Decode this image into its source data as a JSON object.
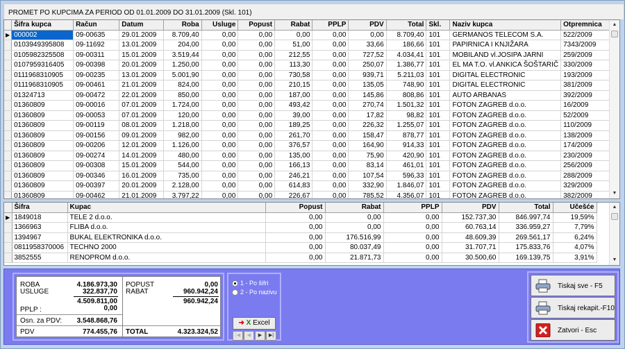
{
  "window": {
    "title": "PROMET PO KUPCIMA ZA PERIOD OD 01.01.2009 DO 31.01.2009 (Skl. 101)"
  },
  "grid1": {
    "columns": [
      "Šifra kupca",
      "Račun",
      "Datum",
      "Roba",
      "Usluge",
      "Popust",
      "Rabat",
      "PPLP",
      "PDV",
      "Total",
      "Skl.",
      "Naziv kupca",
      "Otpremnica"
    ],
    "rows": [
      [
        "000002",
        "09-00635",
        "29.01.2009",
        "8.709,40",
        "0,00",
        "0,00",
        "0,00",
        "0,00",
        "0,00",
        "8.709,40",
        "101",
        "GERMANOS TELECOM S.A.",
        "522/2009"
      ],
      [
        "0103949395808",
        "09-11692",
        "13.01.2009",
        "204,00",
        "0,00",
        "0,00",
        "51,00",
        "0,00",
        "33,66",
        "186,66",
        "101",
        " PAPIRNICA I KNJIŽARA",
        "7343/2009"
      ],
      [
        "0105982325508",
        "09-00311",
        "15.01.2009",
        "3.519,44",
        "0,00",
        "0,00",
        "212,55",
        "0,00",
        "727,52",
        "4.034,41",
        "101",
        "MOBILAND vl.JOSIPA JARNI",
        "259/2009"
      ],
      [
        "0107959316405",
        "09-00398",
        "20.01.2009",
        "1.250,00",
        "0,00",
        "0,00",
        "113,30",
        "0,00",
        "250,07",
        "1.386,77",
        "101",
        "EL MA T.O. vl.ANKICA ŠOŠTARIČ",
        "330/2009"
      ],
      [
        "0111968310905",
        "09-00235",
        "13.01.2009",
        "5.001,90",
        "0,00",
        "0,00",
        "730,58",
        "0,00",
        "939,71",
        "5.211,03",
        "101",
        "DIGITAL ELECTRONIC",
        "193/2009"
      ],
      [
        "0111968310905",
        "09-00461",
        "21.01.2009",
        "824,00",
        "0,00",
        "0,00",
        "210,15",
        "0,00",
        "135,05",
        "748,90",
        "101",
        "DIGITAL ELECTRONIC",
        "381/2009"
      ],
      [
        "01324713",
        "09-00472",
        "22.01.2009",
        "850,00",
        "0,00",
        "0,00",
        "187,00",
        "0,00",
        "145,86",
        "808,86",
        "101",
        "AUTO ARBANAS",
        "392/2009"
      ],
      [
        "01360809",
        "09-00016",
        "07.01.2009",
        "1.724,00",
        "0,00",
        "0,00",
        "493,42",
        "0,00",
        "270,74",
        "1.501,32",
        "101",
        "FOTON ZAGREB d.o.o.",
        "16/2009"
      ],
      [
        "01360809",
        "09-00053",
        "07.01.2009",
        "120,00",
        "0,00",
        "0,00",
        "39,00",
        "0,00",
        "17,82",
        "98,82",
        "101",
        "FOTON ZAGREB d.o.o.",
        "52/2009"
      ],
      [
        "01360809",
        "09-00119",
        "08.01.2009",
        "1.218,00",
        "0,00",
        "0,00",
        "189,25",
        "0,00",
        "226,32",
        "1.255,07",
        "101",
        "FOTON ZAGREB d.o.o.",
        "110/2009"
      ],
      [
        "01360809",
        "09-00156",
        "09.01.2009",
        "982,00",
        "0,00",
        "0,00",
        "261,70",
        "0,00",
        "158,47",
        "878,77",
        "101",
        "FOTON ZAGREB d.o.o.",
        "138/2009"
      ],
      [
        "01360809",
        "09-00206",
        "12.01.2009",
        "1.126,00",
        "0,00",
        "0,00",
        "376,57",
        "0,00",
        "164,90",
        "914,33",
        "101",
        "FOTON ZAGREB d.o.o.",
        "174/2009"
      ],
      [
        "01360809",
        "09-00274",
        "14.01.2009",
        "480,00",
        "0,00",
        "0,00",
        "135,00",
        "0,00",
        "75,90",
        "420,90",
        "101",
        "FOTON ZAGREB d.o.o.",
        "230/2009"
      ],
      [
        "01360809",
        "09-00308",
        "15.01.2009",
        "544,00",
        "0,00",
        "0,00",
        "166,13",
        "0,00",
        "83,14",
        "461,01",
        "101",
        "FOTON ZAGREB d.o.o.",
        "256/2009"
      ],
      [
        "01360809",
        "09-00346",
        "16.01.2009",
        "735,00",
        "0,00",
        "0,00",
        "246,21",
        "0,00",
        "107,54",
        "596,33",
        "101",
        "FOTON ZAGREB d.o.o.",
        "288/2009"
      ],
      [
        "01360809",
        "09-00397",
        "20.01.2009",
        "2.128,00",
        "0,00",
        "0,00",
        "614,83",
        "0,00",
        "332,90",
        "1.846,07",
        "101",
        "FOTON ZAGREB d.o.o.",
        "329/2009"
      ],
      [
        "01360809",
        "09-00462",
        "21.01.2009",
        "3.797,22",
        "0,00",
        "0,00",
        "226,67",
        "0,00",
        "785,52",
        "4.356,07",
        "101",
        "FOTON ZAGREB d.o.o.",
        "382/2009"
      ]
    ]
  },
  "grid2": {
    "columns": [
      "Šifra",
      "Kupac",
      "Popust",
      "Rabat",
      "PPLP",
      "PDV",
      "Total",
      "Učešće"
    ],
    "rows": [
      [
        "1849018",
        "TELE 2 d.o.o.",
        "0,00",
        "0,00",
        "0,00",
        "152.737,30",
        "846.997,74",
        "19,59%"
      ],
      [
        "1366963",
        "FLIBA d.o.o.",
        "0,00",
        "0,00",
        "0,00",
        "60.763,14",
        "336.959,27",
        "7,79%"
      ],
      [
        "1394967",
        "BUKAL ELEKTRONIKA d.o.o.",
        "0,00",
        "176.516,99",
        "0,00",
        "48.609,39",
        "269.561,17",
        "6,24%"
      ],
      [
        "0811958370006",
        "TECHNO 2000",
        "0,00",
        "80.037,49",
        "0,00",
        "31.707,71",
        "175.833,76",
        "4,07%"
      ],
      [
        "3852555",
        "RENOPROM d.o.o.",
        "0,00",
        "21.871,73",
        "0,00",
        "30.500,60",
        "169.139,75",
        "3,91%"
      ]
    ]
  },
  "summary": {
    "roba_label": "ROBA",
    "roba": "4.186.973,30",
    "usluge_label": "USLUGE",
    "usluge": "322.837,70",
    "subtotal1": "4.509.811,00",
    "pplp_label": "PPLP :",
    "pplp": "0,00",
    "osn_label": "Osn. za PDV:",
    "osn": "3.548.868,76",
    "pdv_label": "PDV",
    "pdv": "774.455,76",
    "popust_label": "POPUST",
    "popust": "0,00",
    "rabat_label": "RABAT",
    "rabat": "960.942,24",
    "subtotal2": "960.942,24",
    "total_label": "TOTAL",
    "total": "4.323.324,52"
  },
  "sort": {
    "opt1": "1 - Po šifri",
    "opt2": "2 - Po nazivu",
    "selected": "1 - Po šifri"
  },
  "excel": {
    "label": "Excel"
  },
  "buttons": {
    "print_all": "Tiskaj sve - F5",
    "print_recap": "Tiskaj rekapit.-F10",
    "close": "Zatvori - Esc"
  },
  "icons": {
    "row_pointer": "triangle-right-icon",
    "printer": "printer-icon",
    "close": "red-x-icon",
    "excel": "excel-icon"
  }
}
